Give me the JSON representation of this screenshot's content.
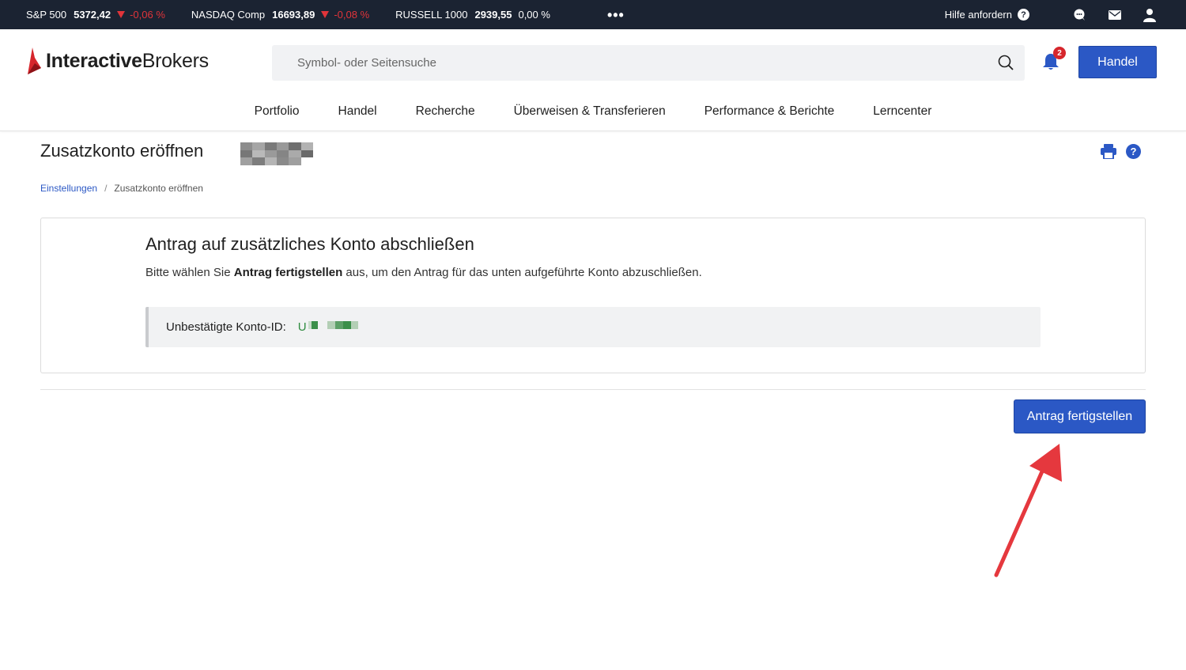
{
  "ticker": [
    {
      "name": "S&P 500",
      "value": "5372,42",
      "change": "-0,06 %",
      "direction": "down"
    },
    {
      "name": "NASDAQ Comp",
      "value": "16693,89",
      "change": "-0,08 %",
      "direction": "down"
    },
    {
      "name": "RUSSELL 1000",
      "value": "2939,55",
      "change": "0,00 %",
      "direction": "flat"
    }
  ],
  "ticker_more": "•••",
  "help_label": "Hilfe anfordern",
  "help_glyph": "?",
  "logo": {
    "part1": "Interactive",
    "part2": "Brokers"
  },
  "search": {
    "placeholder": "Symbol- oder Seitensuche"
  },
  "notifications": {
    "count": "2"
  },
  "trade_button": "Handel",
  "nav": [
    "Portfolio",
    "Handel",
    "Recherche",
    "Überweisen & Transferieren",
    "Performance & Berichte",
    "Lerncenter"
  ],
  "page": {
    "title": "Zusatzkonto eröffnen",
    "help_glyph": "?",
    "breadcrumb": {
      "parent": "Einstellungen",
      "separator": "/",
      "current": "Zusatzkonto eröffnen"
    }
  },
  "card": {
    "title": "Antrag auf zusätzliches Konto abschließen",
    "desc_before": "Bitte wählen Sie ",
    "desc_bold": "Antrag fertigstellen",
    "desc_after": " aus, um den Antrag für das unten aufgeführte Konto abzuschließen.",
    "id_label": "Unbestätigte Konto-ID:",
    "id_prefix": "U"
  },
  "complete_button": "Antrag fertigstellen",
  "colors": {
    "ticker_bg": "#1b2332",
    "accent": "#2b58c5",
    "negative": "#e0343a",
    "badge": "#d6262c",
    "annotation_arrow": "#e5383e",
    "id_text": "#2e8b3f"
  },
  "icons": [
    "chat-icon",
    "mail-icon",
    "user-icon",
    "search-icon",
    "bell-icon",
    "print-icon",
    "help-icon",
    "arrow-annotation"
  ]
}
